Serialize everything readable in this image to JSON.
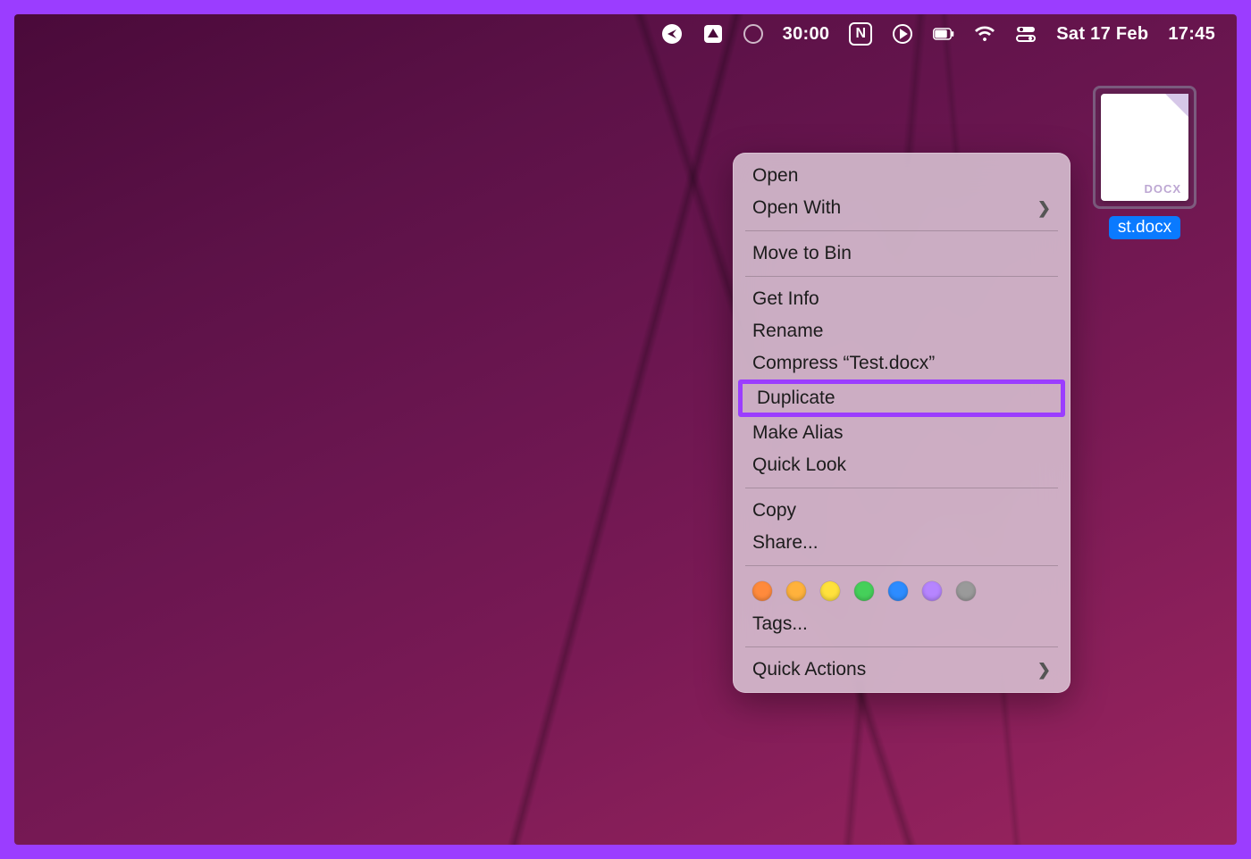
{
  "menubar": {
    "timer": "30:00",
    "date": "Sat 17 Feb",
    "time": "17:45"
  },
  "desktop_file": {
    "doc_badge": "DOCX",
    "visible_name": "st.docx"
  },
  "context_menu": {
    "open": "Open",
    "open_with": "Open With",
    "move_to_bin": "Move to Bin",
    "get_info": "Get Info",
    "rename": "Rename",
    "compress": "Compress “Test.docx”",
    "duplicate": "Duplicate",
    "make_alias": "Make Alias",
    "quick_look": "Quick Look",
    "copy": "Copy",
    "share": "Share...",
    "tags": "Tags...",
    "quick_actions": "Quick Actions"
  },
  "tag_colors": [
    "#ff8a3c",
    "#ffb23c",
    "#ffe13c",
    "#45d05a",
    "#2d8cff",
    "#b685ff",
    "#9a9a9a"
  ],
  "annotation": {
    "highlighted_item": "duplicate",
    "highlight_color": "#9b3dff"
  }
}
